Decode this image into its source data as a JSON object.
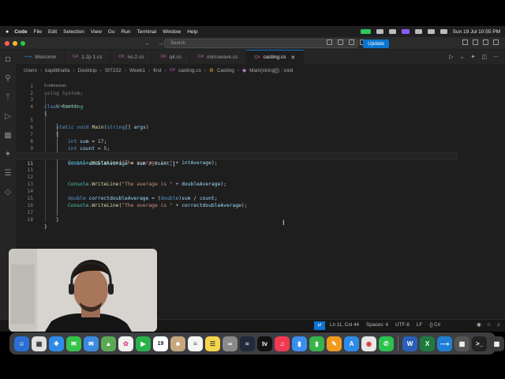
{
  "menubar": {
    "app_name": "Code",
    "items": [
      "File",
      "Edit",
      "Selection",
      "View",
      "Go",
      "Run",
      "Terminal",
      "Window",
      "Help"
    ],
    "datetime": "Sun 19 Jul  10:55 PM"
  },
  "titlebar": {
    "search_placeholder": "Search",
    "update_label": "Update"
  },
  "tabs": [
    {
      "label": "Welcome",
      "icon": "vscode-icon",
      "active": false
    },
    {
      "label": "1.2p 1.cs",
      "icon": "csharp-icon",
      "active": false
    },
    {
      "label": "no.2.cs",
      "icon": "csharp-icon",
      "active": false
    },
    {
      "label": "q4.cs",
      "icon": "csharp-icon",
      "active": false
    },
    {
      "label": "microwave.cs",
      "icon": "csharp-icon",
      "active": false
    },
    {
      "label": "casting.cs",
      "icon": "csharp-icon",
      "active": true
    }
  ],
  "breadcrumb": [
    "Users",
    "kapilbhatta",
    "Desktop",
    "SIT232",
    "Week1",
    "first",
    "casting.cs",
    "Casting",
    "Main(string[]) : void"
  ],
  "codelens": {
    "class_refs": "0 references",
    "method_refs": "0 references"
  },
  "code_lines": {
    "l1": "using System;",
    "l3a": "class",
    "l3b": "Casting",
    "l4": "{",
    "l5a": "static",
    "l5b": "void",
    "l5c": "Main",
    "l5d": "(",
    "l5e": "string",
    "l5f": "[] ",
    "l5g": "args",
    "l5h": ")",
    "l6": "{",
    "l7a": "int",
    "l7b": "sum",
    "l7c": " = ",
    "l7d": "17",
    "l7e": ";",
    "l8a": "int",
    "l8b": "count",
    "l8c": " = ",
    "l8d": "5",
    "l8e": ";",
    "l9a": "int",
    "l9b": "intAverage",
    "l9c": " = ",
    "l9d": "sum",
    "l9e": " / ",
    "l9f": "count",
    "l9g": ";",
    "l10a": "Console",
    "l10b": ".",
    "l10c": "WriteLine",
    "l10d": "(",
    "l10e": "\"The average is \"",
    "l10f": " + ",
    "l10g": "intAverage",
    "l10h": ");",
    "l12a": "double",
    "l12b": "doubleAverage",
    "l12c": " = ",
    "l12d": "sum",
    "l12e": " / ",
    "l12f": "count",
    "l12g": ";",
    "l13a": "Console",
    "l13b": ".",
    "l13c": "WriteLine",
    "l13d": "(",
    "l13e": "\"The average is \"",
    "l13f": " + ",
    "l13g": "doubleAverage",
    "l13h": ");",
    "l15a": "double",
    "l15b": "correctdoubleAverage",
    "l15c": " = (",
    "l15d": "double",
    "l15e": ")",
    "l15f": "sum",
    "l15g": " / ",
    "l15h": "count",
    "l15i": ";",
    "l16a": "Console",
    "l16b": ".",
    "l16c": "WriteLine",
    "l16d": "(",
    "l16e": "\"The average is \"",
    "l16f": " + ",
    "l16g": "correctdoubleAverage",
    "l16h": ");",
    "l18": "}",
    "l19": "}"
  },
  "line_numbers": [
    "1",
    "2",
    "3",
    "4",
    "5",
    "6",
    "7",
    "8",
    "9",
    "10",
    "11",
    "12",
    "13",
    "14",
    "15",
    "16",
    "17",
    "18"
  ],
  "statusbar": {
    "cursor": "Ln 11, Col 44",
    "spaces": "Spaces: 4",
    "encoding": "UTF-8",
    "eol": "LF",
    "language": "{} C#"
  },
  "dock": {
    "calendar_day": "19"
  },
  "colors": {
    "accent": "#0a74d0",
    "editor_bg": "#1e1e1e",
    "keyword": "#569cd6",
    "type": "#4ec9b0",
    "string": "#ce9178",
    "number": "#b5cea8",
    "method": "#dcdcaa",
    "identifier": "#9cdcfe"
  }
}
